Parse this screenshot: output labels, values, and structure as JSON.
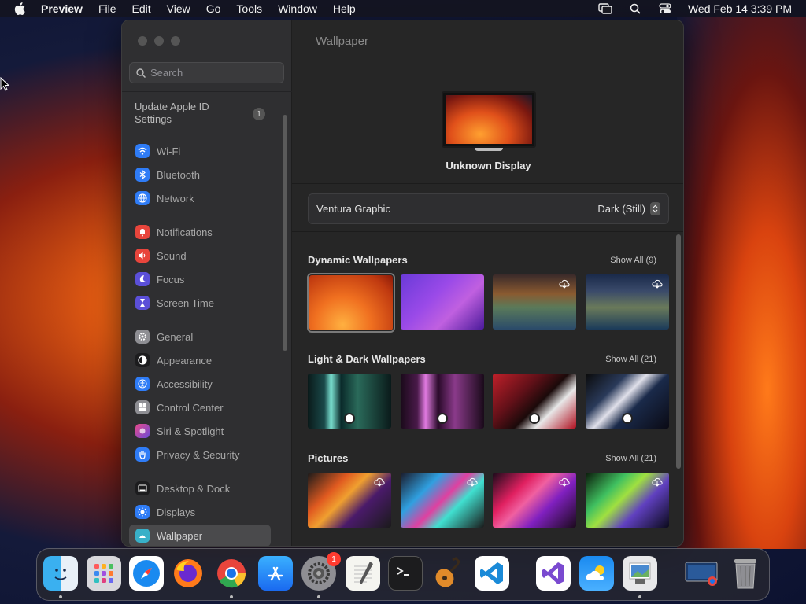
{
  "menubar": {
    "app_name": "Preview",
    "menus": [
      "File",
      "Edit",
      "View",
      "Go",
      "Tools",
      "Window",
      "Help"
    ],
    "clock": "Wed Feb 14  3:39 PM"
  },
  "sidebar": {
    "search_placeholder": "Search",
    "apple_id_label": "Update Apple ID Settings",
    "apple_id_badge": "1",
    "items": [
      {
        "label": "Wi-Fi",
        "icon": "wifi-icon",
        "color": "#2f7cf6"
      },
      {
        "label": "Bluetooth",
        "icon": "bluetooth-icon",
        "color": "#2f7cf6"
      },
      {
        "label": "Network",
        "icon": "globe-icon",
        "color": "#2f7cf6"
      },
      {
        "label": "Notifications",
        "icon": "bell-icon",
        "color": "#e8453c"
      },
      {
        "label": "Sound",
        "icon": "speaker-icon",
        "color": "#e8453c"
      },
      {
        "label": "Focus",
        "icon": "moon-icon",
        "color": "#5b4fd8"
      },
      {
        "label": "Screen Time",
        "icon": "hourglass-icon",
        "color": "#5b4fd8"
      },
      {
        "label": "General",
        "icon": "gear-icon",
        "color": "#8e8e93"
      },
      {
        "label": "Appearance",
        "icon": "appearance-icon",
        "color": "#1c1c1e"
      },
      {
        "label": "Accessibility",
        "icon": "accessibility-icon",
        "color": "#2f7cf6"
      },
      {
        "label": "Control Center",
        "icon": "control-center-icon",
        "color": "#8e8e93"
      },
      {
        "label": "Siri & Spotlight",
        "icon": "siri-icon",
        "color": "#b04ad8"
      },
      {
        "label": "Privacy & Security",
        "icon": "hand-icon",
        "color": "#2f7cf6"
      },
      {
        "label": "Desktop & Dock",
        "icon": "dock-icon",
        "color": "#1c1c1e"
      },
      {
        "label": "Displays",
        "icon": "sun-icon",
        "color": "#2f7cf6"
      },
      {
        "label": "Wallpaper",
        "icon": "wallpaper-icon",
        "color": "#38b0c8"
      }
    ]
  },
  "main": {
    "title": "Wallpaper",
    "display_name": "Unknown Display",
    "current_wallpaper": "Ventura Graphic",
    "appearance_mode": "Dark (Still)",
    "sections": [
      {
        "title": "Dynamic Wallpapers",
        "show_all": "Show All (9)"
      },
      {
        "title": "Light & Dark Wallpapers",
        "show_all": "Show All (21)"
      },
      {
        "title": "Pictures",
        "show_all": "Show All (21)"
      }
    ]
  },
  "dock": {
    "apps": [
      {
        "name": "Finder",
        "icon": "finder-icon"
      },
      {
        "name": "Launchpad",
        "icon": "launchpad-icon"
      },
      {
        "name": "Safari",
        "icon": "safari-icon"
      },
      {
        "name": "Firefox",
        "icon": "firefox-icon"
      },
      {
        "name": "Chrome",
        "icon": "chrome-icon"
      },
      {
        "name": "App Store",
        "icon": "app-store-icon"
      },
      {
        "name": "System Settings",
        "icon": "system-settings-icon"
      },
      {
        "name": "TextEdit",
        "icon": "textedit-icon"
      },
      {
        "name": "Terminal",
        "icon": "terminal-icon"
      },
      {
        "name": "GarageBand",
        "icon": "guitar-icon"
      },
      {
        "name": "VS Code",
        "icon": "vscode-icon"
      },
      {
        "name": "Visual Studio",
        "icon": "visual-studio-icon"
      },
      {
        "name": "Weather",
        "icon": "weather-icon"
      },
      {
        "name": "Preview",
        "icon": "preview-icon"
      },
      {
        "name": "Screen Sharing",
        "icon": "screen-sharing-icon"
      },
      {
        "name": "Trash",
        "icon": "trash-icon"
      }
    ],
    "settings_badge": "1"
  }
}
